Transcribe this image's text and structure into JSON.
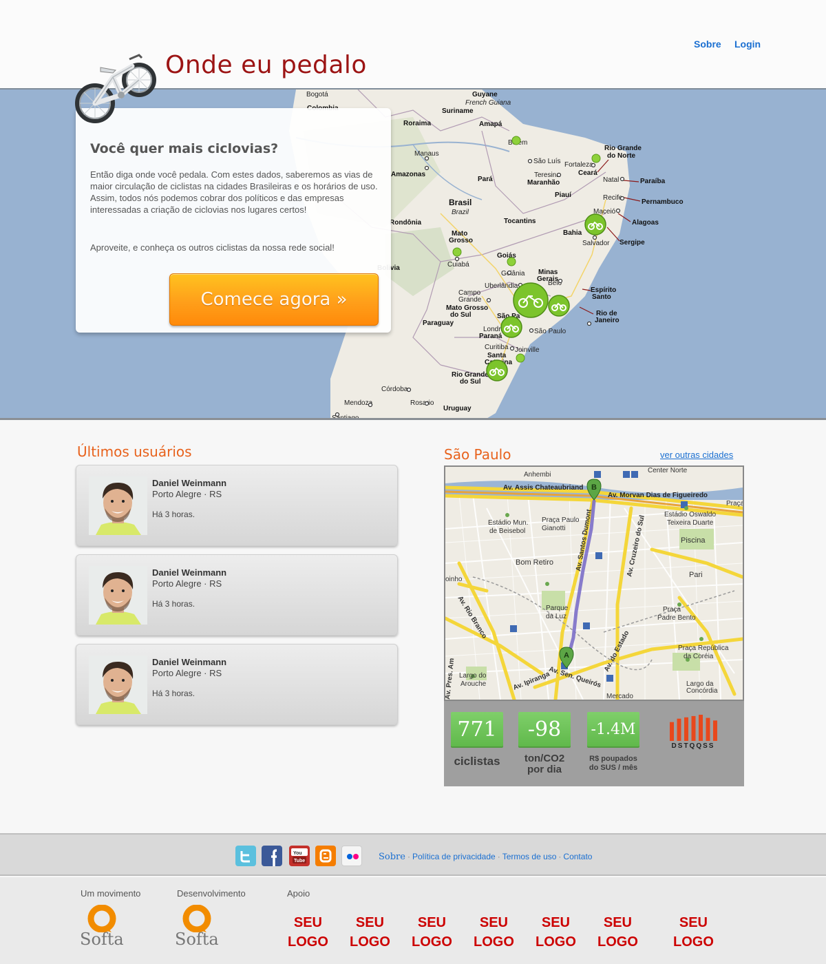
{
  "header": {
    "site_title": "Onde eu pedalo",
    "nav": {
      "sobre": "Sobre",
      "login": "Login"
    }
  },
  "hero": {
    "heading": "Você quer mais ciclovias?",
    "body": "Então diga onde você pedala. Com estes dados, saberemos as vias de maior circulação de ciclistas na cidades Brasileiras e os horários de uso. Assim, todos nós podemos cobrar dos políticos e das empresas interessadas a criação de ciclovias nos lugares certos!",
    "cta_text": "Aproveite, e conheça os outros ciclistas da nossa rede social!",
    "button": "Comece agora  »",
    "map_labels": {
      "guyane": "Guyane",
      "french_guiana": "French Guiana",
      "suriname": "Suriname",
      "bogota": "Bogotá",
      "colombia": "Colombia",
      "roraima": "Roraima",
      "amapa": "Amapá",
      "belem": "Belém",
      "manaus": "Manaus",
      "sao_luis": "São Luís",
      "fortaleza": "Fortaleza",
      "rio_grande_do_norte": "Rio Grande do Norte",
      "amazonas": "Amazonas",
      "para": "Pará",
      "teresina": "Teresina",
      "maranhao": "Maranhão",
      "ceara": "Ceará",
      "natal": "Natal",
      "paraiba": "Paraíba",
      "piaui": "Piauí",
      "recife": "Recife",
      "pernambuco": "Pernambuco",
      "brasil": "Brasil",
      "brazil": "Brazil",
      "maceio": "Maceió",
      "alagoas": "Alagoas",
      "rondonia": "Rondônia",
      "tocantins": "Tocantins",
      "bahia": "Bahia",
      "salvador": "Salvador",
      "sergipe": "Sergipe",
      "mato_grosso": "Mato Grosso",
      "goias": "Goiás",
      "cuiaba": "Cuiabá",
      "goiania": "Goiânia",
      "bolivia": "Bolivia",
      "minas_gerais": "Minas Gerais",
      "belo": "Belo",
      "uberlandia": "Uberlândia",
      "espirito_santo": "Espírito Santo",
      "campo_grande": "Campo Grande",
      "mato_grosso_do_sul": "Mato Grosso do Sul",
      "rio_de_janeiro": "Rio de Janeiro",
      "sao_paulo_state": "São Pa",
      "paraguay": "Paraguay",
      "londrina": "Londri",
      "sao_paulo_city": "São Paulo",
      "parana": "Paraná",
      "curitiba": "Curitiba",
      "joinville": "Joinville",
      "santa_catarina": "Santa Catarina",
      "rio_grande_do_sul": "Rio Grande do Sul",
      "cordoba": "Córdoba",
      "rosario": "Rosario",
      "uruguay": "Uruguay",
      "mendoza": "Mendoza",
      "santiago": "Santiago"
    }
  },
  "users": {
    "title": "Últimos usuários",
    "items": [
      {
        "name": "Daniel Weinmann",
        "location": "Porto Alegre · RS",
        "time": "Há 3 horas."
      },
      {
        "name": "Daniel Weinmann",
        "location": "Porto Alegre · RS",
        "time": "Há 3 horas."
      },
      {
        "name": "Daniel Weinmann",
        "location": "Porto Alegre · RS",
        "time": "Há 3 horas."
      }
    ]
  },
  "city": {
    "title": "São Paulo",
    "other_cities": "ver outras cidades",
    "map_labels": {
      "anhembi": "Anhembi",
      "center_norte": "Center Norte",
      "av_assis": "Av. Assis Chateaubriand",
      "av_morvan": "Av. Morvan Dias de Figueiredo",
      "praca": "Praça",
      "estadio_mun": "Estádio Mun. de Beisebol",
      "praca_paulo": "Praça Paulo Gianotti",
      "estadio_oswaldo": "Estádio Oswaldo Teixeira Duarte",
      "piscina": "Piscina",
      "bom_retiro": "Bom Retiro",
      "pari": "Pari",
      "av_santos_dumont": "Av. Santos Dumont",
      "av_cruzeiro": "Av. Cruzeiro do Sul",
      "parque_da_luz": "Parque da Luz",
      "av_rio_branco": "Av. Rio Branco",
      "praca_padre_bento": "Praça Padre Bento",
      "praca_republica_coreia": "Praça República da Coréia",
      "av_do_estado": "Av. do Estado",
      "largo_arouche": "Largo do Arouche",
      "av_ipiranga": "Av. Ipiranga",
      "av_sen_queiros": "Av. Sen. Queirós",
      "largo_concordia": "Largo da Concórdia",
      "mercado": "Mercado",
      "pres_am": "Av. Pres. Am",
      "oinho": "oinho"
    },
    "markers": {
      "start": "A",
      "end": "B"
    },
    "stats": {
      "cyclists_value": "771",
      "cyclists_label": "ciclistas",
      "co2_value": "-98",
      "co2_label_1": "ton/CO2",
      "co2_label_2": "por dia",
      "money_value": "-1.4M",
      "money_label_1": "R$ poupados",
      "money_label_2": "do SUS / mês",
      "weekdays": "DSTQQSS",
      "weekday_levels": [
        0.72,
        0.85,
        0.9,
        0.95,
        1.0,
        0.88,
        0.78
      ]
    }
  },
  "footer": {
    "social": [
      "twitter-icon",
      "facebook-icon",
      "youtube-icon",
      "blogger-icon",
      "flickr-icon"
    ],
    "links": {
      "sobre": "Sobre",
      "privacidade": "Política de privacidade",
      "termos": "Termos de uso",
      "contato": "Contato"
    },
    "movement_heading": "Um movimento",
    "development_heading": "Desenvolvimento",
    "support_heading": "Apoio",
    "softa_1": "Softa",
    "softa_2": "Softa",
    "sponsor_logo_line1": "SEU",
    "sponsor_logo_line2": "LOGO"
  },
  "colors": {
    "brand_red": "#9c1414",
    "section_orange": "#e8621c",
    "link_blue": "#1a6fd1",
    "stat_green": "#6cc257",
    "cta_orange": "#ff9f1a",
    "sponsor_red": "#cc0000",
    "map_water": "#98b2d1"
  }
}
